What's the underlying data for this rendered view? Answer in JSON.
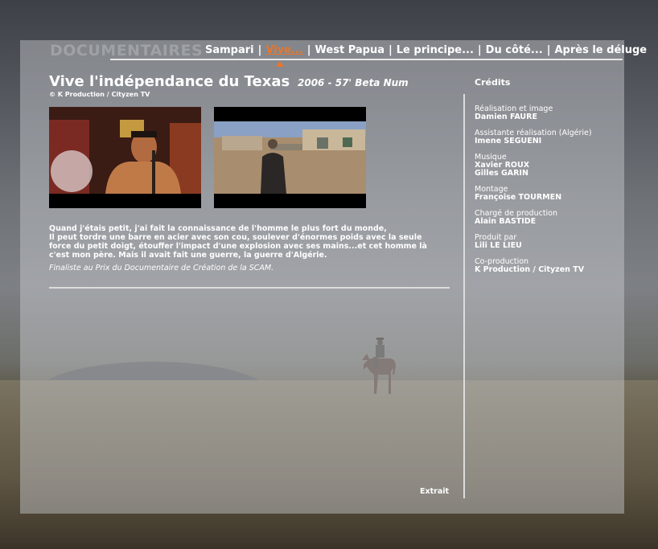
{
  "nav": {
    "section_title": "DOCUMENTAIRES",
    "items": [
      {
        "label": "Sampari",
        "active": false
      },
      {
        "label": "Vive...",
        "active": true
      },
      {
        "label": "West Papua",
        "active": false
      },
      {
        "label": "Le principe...",
        "active": false
      },
      {
        "label": "Du côté...",
        "active": false
      },
      {
        "label": "Après le déluge",
        "active": false
      }
    ],
    "separator": "|"
  },
  "film": {
    "title": "Vive l'indépendance du Texas",
    "meta": "2006 - 57' Beta Num",
    "copyright": "©  K Production / Cityzen TV",
    "synopsis_lines": [
      "Quand j'étais petit, j'ai fait la connaissance de l'homme le plus fort du monde,",
      "Il peut tordre une barre en acier avec son cou, soulever d'énormes poids avec la seule",
      "force du petit doigt, étouffer l'impact d'une explosion avec ses mains...et cet homme là",
      "c'est mon père. Mais il avait fait une guerre, la guerre d'Algérie."
    ],
    "award": "Finaliste au Prix du Documentaire de Création de la SCAM.",
    "extract_link": "Extrait"
  },
  "credits": {
    "title": "Crédits",
    "items": [
      {
        "role": "Réalisation et image",
        "names": [
          "Damien FAURE"
        ]
      },
      {
        "role": "Assistante réalisation (Algérie)",
        "names": [
          "Imene SEGUENI"
        ]
      },
      {
        "role": "Musique",
        "names": [
          "Xavier ROUX",
          "Gilles GARIN"
        ]
      },
      {
        "role": "Montage",
        "names": [
          "Françoise TOURMEN"
        ]
      },
      {
        "role": "Chargé de production",
        "names": [
          "Alain BASTIDE"
        ]
      },
      {
        "role": "Produit par",
        "names": [
          "Lili LE LIEU"
        ]
      },
      {
        "role": "Co-production",
        "names": [
          "K Production / Cityzen TV"
        ]
      }
    ]
  },
  "colors": {
    "accent": "#e8762a",
    "text": "#ffffff",
    "nav_title": "#9ea1a5"
  }
}
